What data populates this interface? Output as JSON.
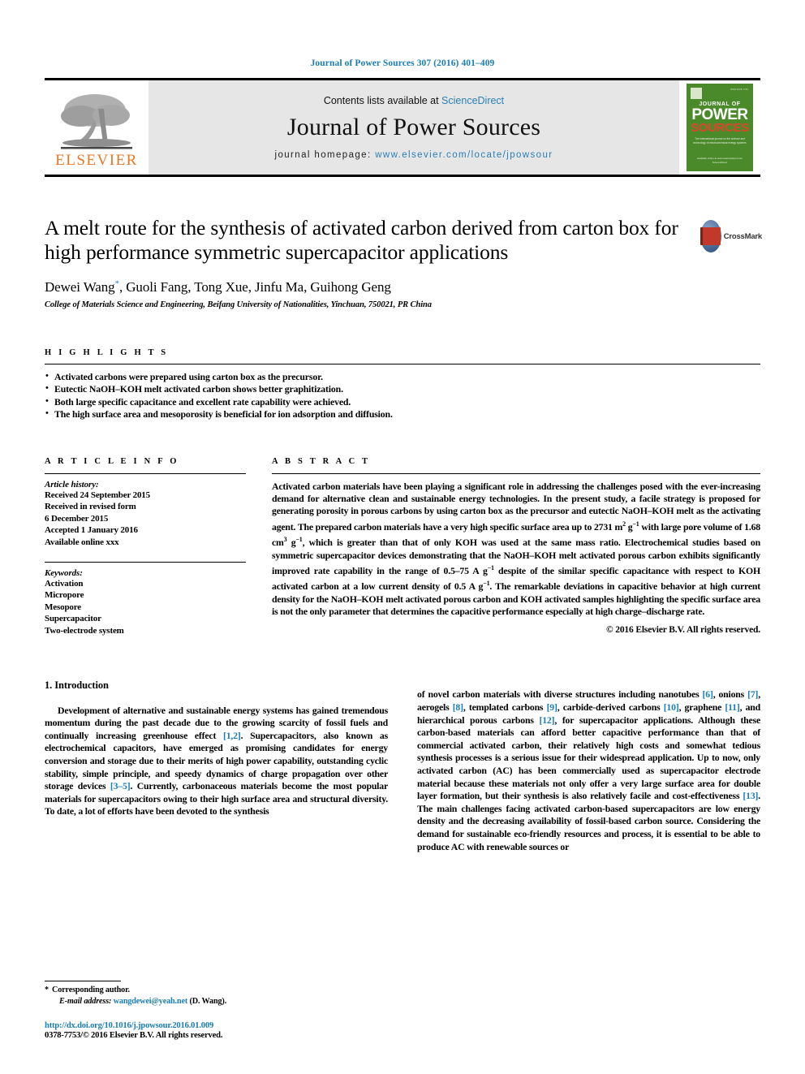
{
  "running_head": "Journal of Power Sources 307 (2016) 401–409",
  "masthead": {
    "contents_prefix": "Contents lists available at ",
    "contents_link": "ScienceDirect",
    "journal_title": "Journal of Power Sources",
    "homepage_prefix": "journal homepage: ",
    "homepage_url": "www.elsevier.com/locate/jpowsour",
    "publisher": "ELSEVIER",
    "publisher_logo_icon": "elsevier-tree-icon",
    "cover": {
      "journal_of": "JOURNAL OF",
      "power": "POWER",
      "sources": "SOURCES",
      "subtitle": "The international journal on the science and technology of electrochemical energy systems",
      "footer": "Available online at www.sciencedirect.com  ScienceDirect",
      "issn": "ISSN 0378-7753"
    }
  },
  "article": {
    "title": "A melt route for the synthesis of activated carbon derived from carton box for high performance symmetric supercapacitor applications",
    "authors": "Dewei Wang, Guoli Fang, Tong Xue, Jinfu Ma, Guihong Geng",
    "corresponding_marker": "*",
    "affiliation": "College of Materials Science and Engineering, Beifang University of Nationalities, Yinchuan, 750021, PR China",
    "crossmark_label": "CrossMark",
    "crossmark_icon": "crossmark-icon"
  },
  "highlights": {
    "label": "H I G H L I G H T S",
    "items": [
      "Activated carbons were prepared using carton box as the precursor.",
      "Eutectic NaOH–KOH melt activated carbon shows better graphitization.",
      "Both large specific capacitance and excellent rate capability were achieved.",
      "The high surface area and mesoporosity is beneficial for ion adsorption and diffusion."
    ]
  },
  "article_info": {
    "label": "A R T I C L E   I N F O",
    "history_label": "Article history:",
    "history": [
      "Received 24 September 2015",
      "Received in revised form",
      "6 December 2015",
      "Accepted 1 January 2016",
      "Available online xxx"
    ],
    "keywords_label": "Keywords:",
    "keywords": [
      "Activation",
      "Micropore",
      "Mesopore",
      "Supercapacitor",
      "Two-electrode system"
    ]
  },
  "abstract": {
    "label": "A B S T R A C T",
    "part1": "Activated carbon materials have been playing a significant role in addressing the challenges posed with the ever-increasing demand for alternative clean and sustainable energy technologies. In the present study, a facile strategy is proposed for generating porosity in porous carbons by using carton box as the precursor and eutectic NaOH–KOH melt as the activating agent. The prepared carbon materials have a very high specific surface area up to 2731 m",
    "sup1": "2",
    "part2": " g",
    "sup2": "−1",
    "part3": " with large pore volume of 1.68 cm",
    "sup3": "3",
    "part4": " g",
    "sup4": "−1",
    "part5": ", which is greater than that of only KOH was used at the same mass ratio. Electrochemical studies based on symmetric supercapacitor devices demonstrating that the NaOH–KOH melt activated porous carbon exhibits significantly improved rate capability in the range of 0.5–75 A g",
    "sup5": "−1",
    "part6": " despite of the similar specific capacitance with respect to KOH activated carbon at a low current density of 0.5 A g",
    "sup6": "−1",
    "part7": ". The remarkable deviations in capacitive behavior at high current density for the NaOH–KOH melt activated porous carbon and KOH activated samples highlighting the specific surface area is not the only parameter that determines the capacitive performance especially at high charge–discharge rate.",
    "copyright": "© 2016 Elsevier B.V. All rights reserved."
  },
  "body": {
    "section_heading": "1. Introduction",
    "left_part1": "Development of alternative and sustainable energy systems has gained tremendous momentum during the past decade due to the growing scarcity of fossil fuels and continually increasing greenhouse effect ",
    "left_ref1": "[1,2]",
    "left_part2": ". Supercapacitors, also known as electrochemical capacitors, have emerged as promising candidates for energy conversion and storage due to their merits of high power capability, outstanding cyclic stability, simple principle, and speedy dynamics of charge propagation over other storage devices ",
    "left_ref2": "[3–5]",
    "left_part3": ". Currently, carbonaceous materials become the most popular materials for supercapacitors owing to their high surface area and structural diversity. To date, a lot of efforts have been devoted to the synthesis",
    "right_part1": "of novel carbon materials with diverse structures including nanotubes ",
    "right_ref1": "[6]",
    "right_part2": ", onions ",
    "right_ref2": "[7]",
    "right_part3": ", aerogels ",
    "right_ref3": "[8]",
    "right_part4": ", templated carbons ",
    "right_ref4": "[9]",
    "right_part5": ", carbide-derived carbons ",
    "right_ref5": "[10]",
    "right_part6": ", graphene ",
    "right_ref6": "[11]",
    "right_part7": ", and hierarchical porous carbons ",
    "right_ref7": "[12]",
    "right_part8": ", for supercapacitor applications. Although these carbon-based materials can afford better capacitive performance than that of commercial activated carbon, their relatively high costs and somewhat tedious synthesis processes is a serious issue for their widespread application. Up to now, only activated carbon (AC) has been commercially used as supercapacitor electrode material because these materials not only offer a very large surface area for double layer formation, but their synthesis is also relatively facile and cost-effectiveness ",
    "right_ref8": "[13]",
    "right_part9": ". The main challenges facing activated carbon-based supercapacitors are low energy density and the decreasing availability of fossil-based carbon source. Considering the demand for sustainable eco-friendly resources and process, it is essential to be able to produce AC with renewable sources or"
  },
  "footnote": {
    "corresponding": "Corresponding author.",
    "email_label": "E-mail address:",
    "email": "wangdewei@yeah.net",
    "email_suffix": "(D. Wang).",
    "doi": "http://dx.doi.org/10.1016/j.jpowsour.2016.01.009",
    "issn_line": "0378-7753/© 2016 Elsevier B.V. All rights reserved."
  },
  "colors": {
    "link_blue": "#1a7db6",
    "elsevier_orange": "#e87722",
    "cover_green": "#4a8a2a",
    "cover_red": "#e0452c"
  }
}
